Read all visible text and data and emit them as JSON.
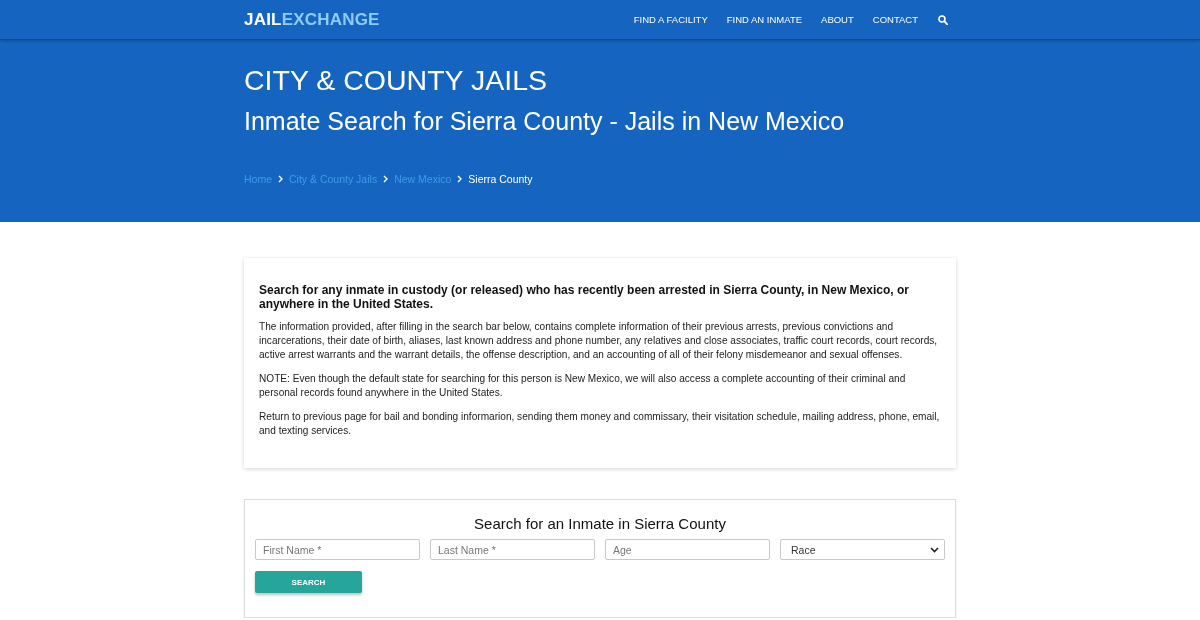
{
  "header": {
    "logo": {
      "text": "JAIL",
      "accent": "EXCHANGE"
    },
    "nav": [
      "FIND A FACILITY",
      "FIND AN INMATE",
      "ABOUT",
      "CONTACT"
    ]
  },
  "hero": {
    "category": "CITY & COUNTY JAILS",
    "title": "Inmate Search for Sierra County - Jails in New Mexico",
    "breadcrumb": [
      {
        "label": "Home",
        "kind": "link"
      },
      {
        "label": "City & County Jails",
        "kind": "link"
      },
      {
        "label": "New Mexico",
        "kind": "link"
      },
      {
        "label": "Sierra County",
        "kind": "current"
      }
    ]
  },
  "intro": {
    "heading": "Search for any inmate in custody (or released) who has recently been arrested in Sierra County, in New Mexico, or anywhere in the United States.",
    "paragraphs": [
      "The information provided, after filling in the search bar below, contains complete information of their previous arrests, previous convictions and incarcerations, their date of birth, aliases, last known address and phone number, any relatives and close associates, traffic court records, court records, active arrest warrants and the warrant details, the offense description, and an accounting of all of their felony misdemeanor and sexual offenses.",
      "NOTE: Even though the default state for searching for this person is New Mexico, we will also access a complete accounting of their criminal and personal records found anywhere in the United States.",
      "Return to previous page for bail and bonding informarion, sending them money and commissary, their visitation schedule, mailing address, phone, email, and texting services."
    ]
  },
  "search_form": {
    "title": "Search for an Inmate in Sierra County",
    "fields": [
      {
        "kind": "text",
        "placeholder": "First Name *"
      },
      {
        "kind": "text",
        "placeholder": "Last Name *"
      },
      {
        "kind": "text",
        "placeholder": "Age"
      },
      {
        "kind": "select",
        "value": "Race"
      }
    ],
    "button": "SEARCH"
  }
}
